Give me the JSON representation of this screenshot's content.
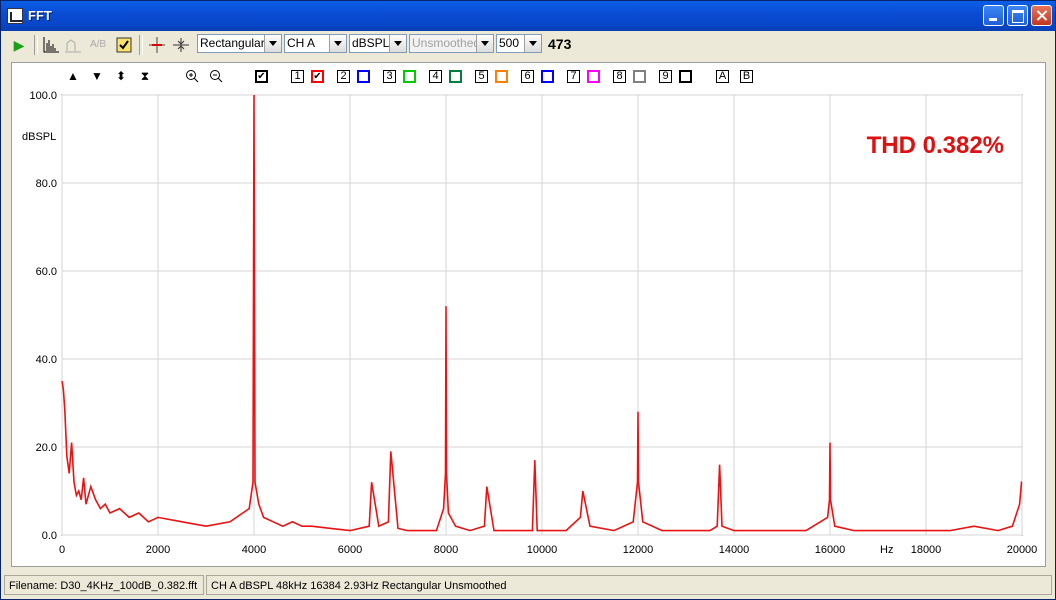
{
  "window": {
    "title": "FFT"
  },
  "toolbar": {
    "window_type": "Rectangular",
    "channel": "CH A",
    "units": "dBSPL",
    "smoothing": "Unsmoothed",
    "points": "500",
    "count": "473"
  },
  "channels": [
    "1",
    "2",
    "3",
    "4",
    "5",
    "6",
    "7",
    "8",
    "9"
  ],
  "channel_colors": [
    "#ff0000",
    "#0000ff",
    "#00cc00",
    "#008040",
    "#ff8000",
    "#0000ff",
    "#ff00ff",
    "#808080",
    "#000000"
  ],
  "markers": [
    "A",
    "B"
  ],
  "status": {
    "filename": "Filename: D30_4KHz_100dB_0.382.fft",
    "info": "CH A   dBSPL   48kHz   16384   2.93Hz   Rectangular   Unsmoothed"
  },
  "chart_data": {
    "type": "line",
    "annotation": "THD 0.382%",
    "xlabel": "Hz",
    "ylabel": "dBSPL",
    "xlim": [
      0,
      20000
    ],
    "ylim": [
      0,
      100
    ],
    "x_ticks": [
      "0",
      "2000",
      "4000",
      "6000",
      "8000",
      "10000",
      "12000",
      "14000",
      "16000",
      "18000",
      "20000"
    ],
    "y_ticks": [
      "0.0",
      "20.0",
      "40.0",
      "60.0",
      "80.0",
      "100.0"
    ],
    "grid": true,
    "series": [
      {
        "color": "#ee1111",
        "x": [
          0,
          30,
          60,
          100,
          150,
          200,
          250,
          300,
          350,
          400,
          450,
          500,
          600,
          700,
          800,
          900,
          1000,
          1200,
          1400,
          1600,
          1800,
          2000,
          2500,
          3000,
          3500,
          3900,
          3980,
          4000,
          4020,
          4100,
          4200,
          4400,
          4600,
          4800,
          5000,
          5200,
          5600,
          6000,
          6400,
          6450,
          6600,
          6800,
          6850,
          7000,
          7200,
          7400,
          7600,
          7800,
          7950,
          7990,
          8000,
          8010,
          8050,
          8200,
          8500,
          8800,
          8850,
          9000,
          9500,
          9800,
          9850,
          9900,
          10200,
          10500,
          10800,
          10850,
          11000,
          11500,
          11900,
          11990,
          12000,
          12010,
          12100,
          12500,
          13000,
          13500,
          13650,
          13700,
          13750,
          14000,
          14500,
          15000,
          15500,
          15950,
          15990,
          16000,
          16010,
          16100,
          16500,
          17000,
          17500,
          18000,
          18500,
          19000,
          19500,
          19800,
          19950,
          19990,
          20000
        ],
        "y": [
          35,
          33,
          28,
          18,
          14,
          21,
          12,
          9,
          10,
          8,
          13,
          7,
          11,
          8,
          6,
          7,
          5,
          6,
          4,
          5,
          3,
          4,
          3,
          2,
          3,
          6,
          12,
          100,
          12,
          7,
          4,
          3,
          2,
          3,
          2,
          2,
          1.5,
          1,
          2,
          12,
          2,
          3,
          19,
          1.5,
          1,
          1,
          1,
          1,
          6,
          14,
          52,
          14,
          5,
          2,
          1,
          2,
          11,
          1,
          1,
          1,
          17,
          1,
          1,
          1,
          4,
          10,
          2,
          1,
          3,
          12,
          28,
          12,
          3,
          1,
          1,
          1,
          2,
          16,
          2,
          1,
          1,
          1,
          1,
          4,
          8,
          21,
          8,
          2,
          1,
          1,
          1,
          1,
          1,
          2,
          1,
          2,
          7,
          12,
          12
        ]
      }
    ]
  }
}
